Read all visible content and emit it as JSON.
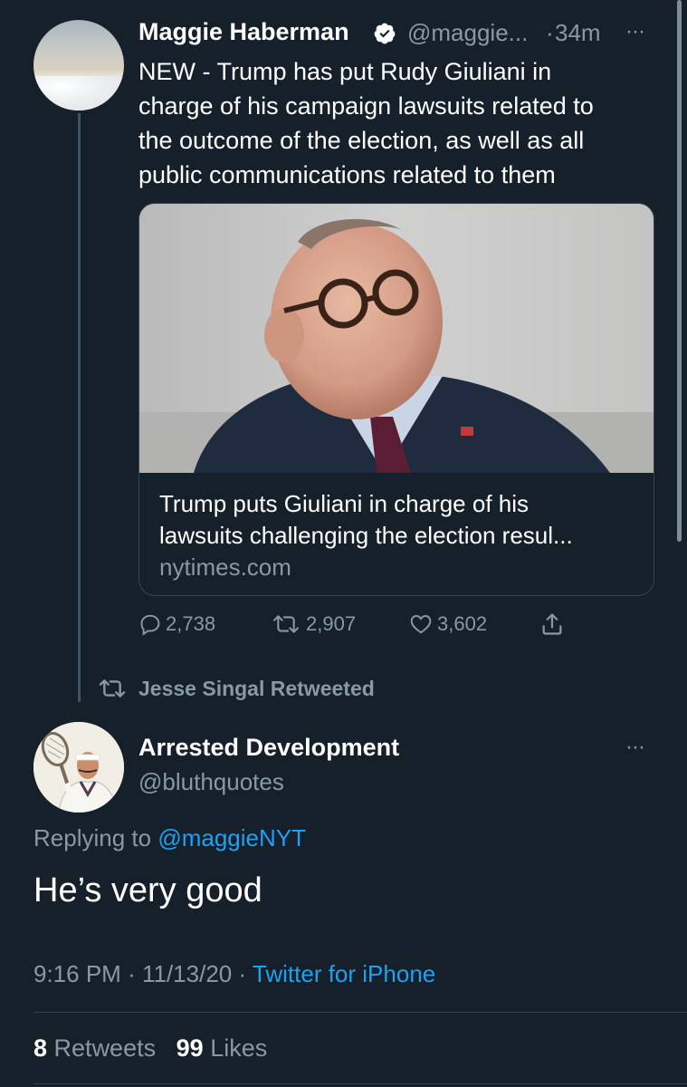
{
  "tweet1": {
    "author_name": "Maggie Haberman",
    "handle": "@maggie...",
    "separator": "·",
    "time": "34m",
    "more": "···",
    "body_lines": [
      "NEW - Trump has put Rudy Giuliani in",
      "charge of his campaign lawsuits related to",
      "the outcome of the election, as well as all",
      "public communications related to them"
    ],
    "card": {
      "title_lines": [
        "Trump puts Giuliani in charge of his",
        "lawsuits challenging the election resul..."
      ],
      "domain": "nytimes.com"
    },
    "actions": {
      "replies": "2,738",
      "retweets": "2,907",
      "likes": "3,602"
    }
  },
  "retweeted_label": "Jesse Singal Retweeted",
  "tweet2": {
    "author_name": "Arrested Development",
    "handle": "@bluthquotes",
    "more": "···",
    "replying_prefix": "Replying to",
    "replying_handle": "@maggieNYT",
    "body": "He’s very good",
    "time": "9:16 PM",
    "date": "11/13/20",
    "sep": "·",
    "source": "Twitter for iPhone",
    "retweet_count": "8",
    "retweet_label": "Retweets",
    "like_count": "99",
    "like_label": "Likes"
  },
  "colors": {
    "background": "#15202b",
    "secondary_text": "#8899a6",
    "link": "#1da1f2",
    "border": "#38444d"
  },
  "icons": [
    "verified-badge-icon",
    "reply-icon",
    "retweet-icon",
    "like-icon",
    "share-icon",
    "more-icon"
  ]
}
